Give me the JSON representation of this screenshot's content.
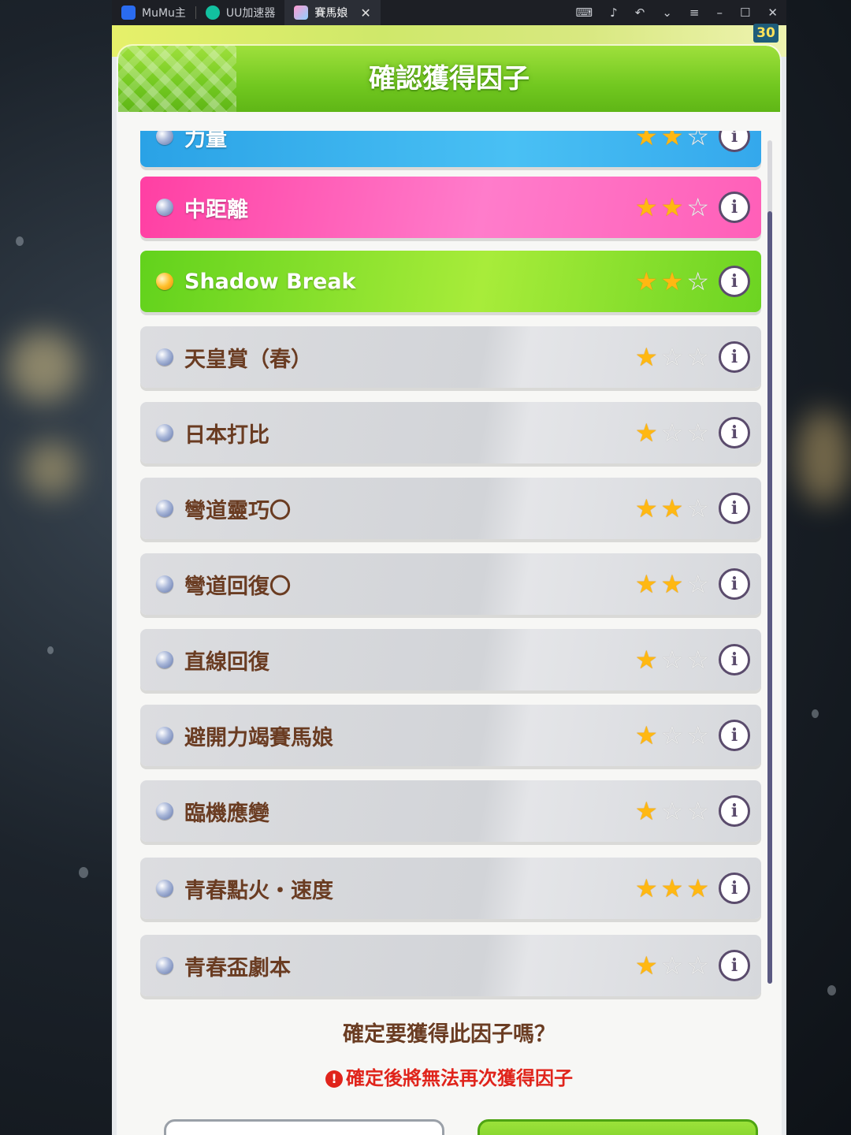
{
  "tabs": [
    {
      "label": "MuMu主",
      "icon": "mumu-logo-icon",
      "active": false
    },
    {
      "label": "UU加速器",
      "icon": "uu-logo-icon",
      "active": false
    },
    {
      "label": "賽馬娘",
      "icon": "umamusume-app-icon",
      "active": true
    }
  ],
  "tab_close": "✕",
  "fps": "30",
  "dialog": {
    "title": "確認獲得因子",
    "confirm_question": "確定要獲得此因子嗎？",
    "warning": "確定後將無法再次獲得因子",
    "warning_icon": "!"
  },
  "factors": [
    {
      "name": "力量",
      "stars": 2,
      "color": "blue"
    },
    {
      "name": "中距離",
      "stars": 2,
      "color": "pink"
    },
    {
      "name": "Shadow Break",
      "stars": 2,
      "color": "green"
    },
    {
      "name": "天皇賞（春）",
      "stars": 1,
      "color": "gray"
    },
    {
      "name": "日本打比",
      "stars": 1,
      "color": "gray"
    },
    {
      "name": "彎道靈巧〇",
      "stars": 2,
      "color": "gray"
    },
    {
      "name": "彎道回復〇",
      "stars": 2,
      "color": "gray"
    },
    {
      "name": "直線回復",
      "stars": 1,
      "color": "gray"
    },
    {
      "name": "避開力竭賽馬娘",
      "stars": 1,
      "color": "gray"
    },
    {
      "name": "臨機應變",
      "stars": 1,
      "color": "gray"
    },
    {
      "name": "青春點火・速度",
      "stars": 3,
      "color": "gray"
    },
    {
      "name": "青春盃劇本",
      "stars": 1,
      "color": "gray"
    }
  ],
  "info_label": "i",
  "colors": {
    "header_green": "#72c820",
    "text_brown": "#6a3c22",
    "warning_red": "#e0241b",
    "star_gold": "#ffb812"
  }
}
